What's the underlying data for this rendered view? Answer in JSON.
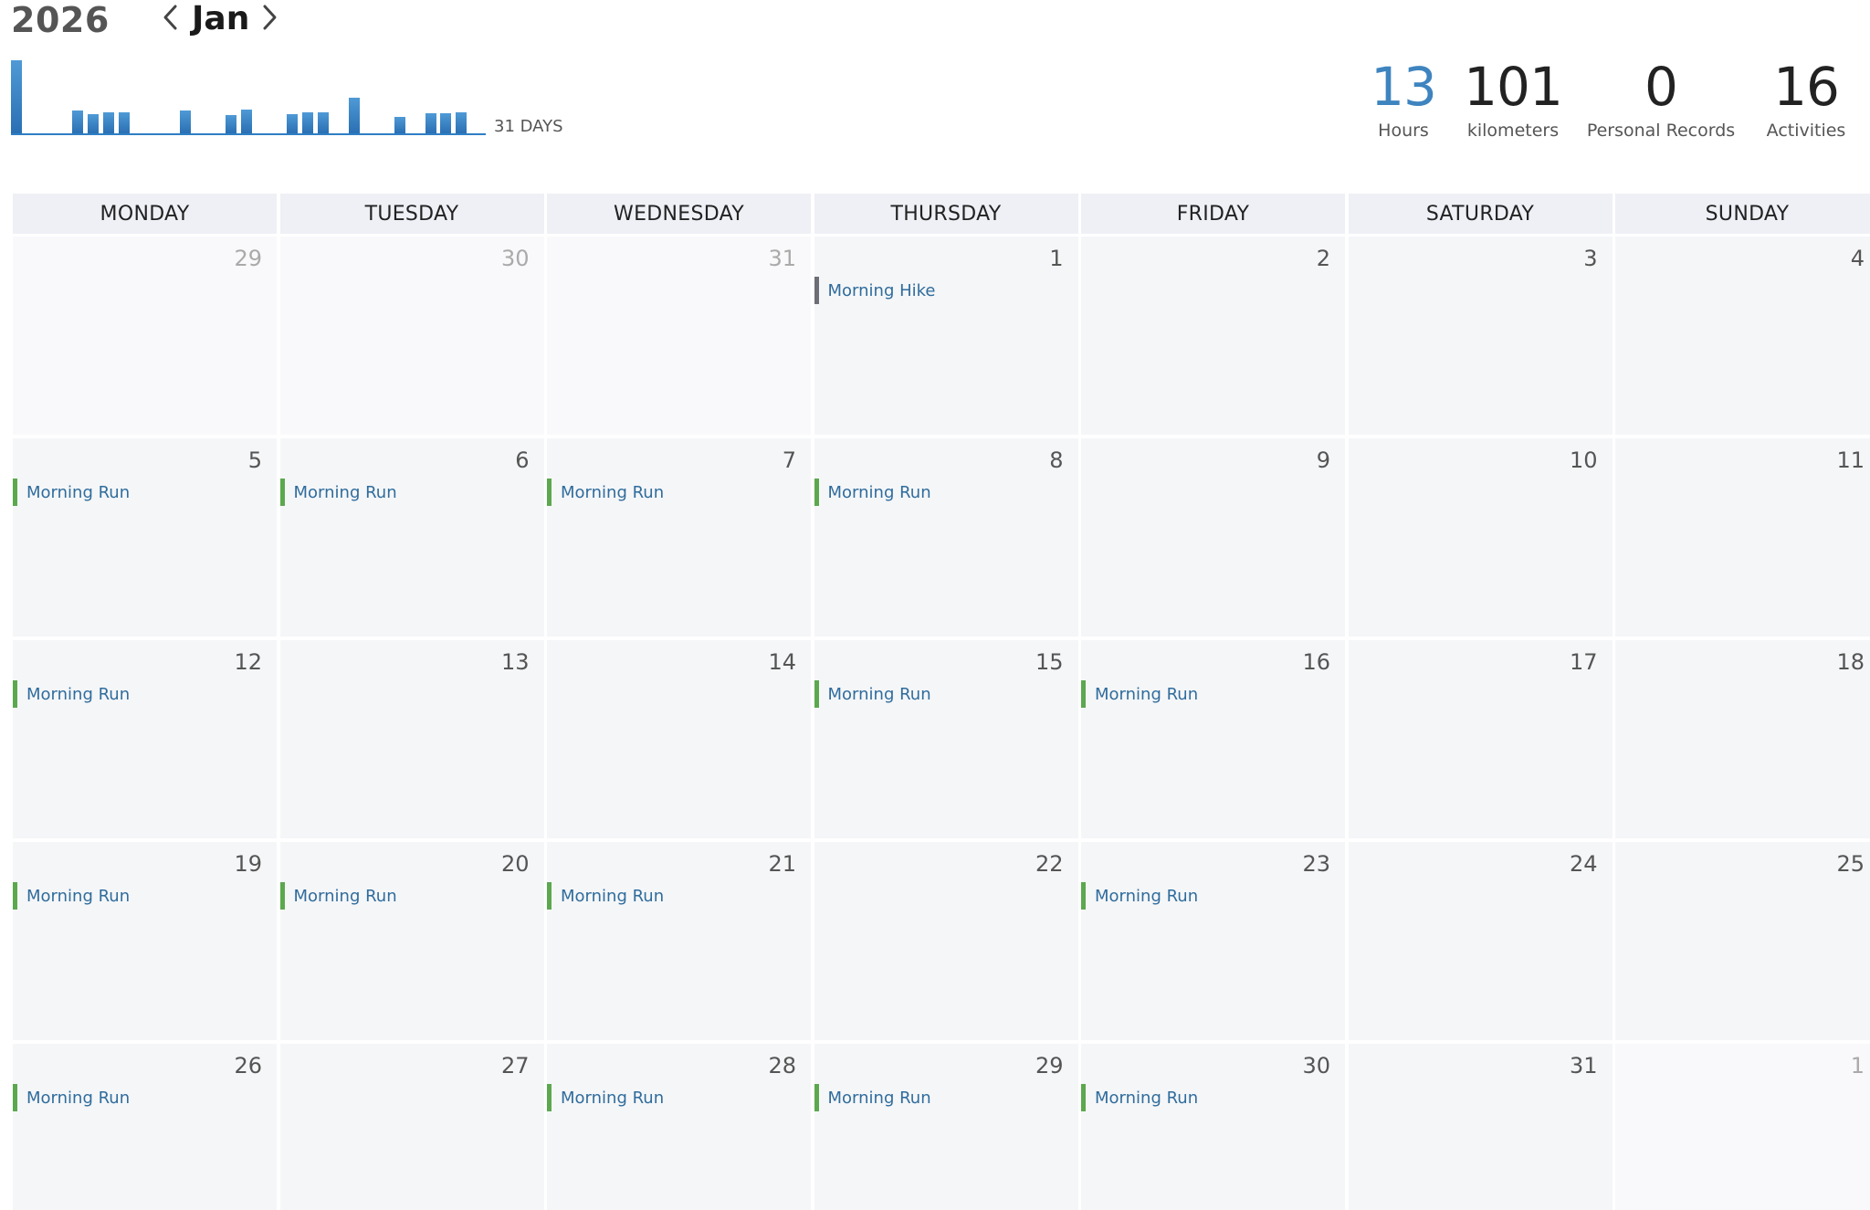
{
  "header": {
    "year": "2026",
    "month": "Jan",
    "days_label": "31 DAYS"
  },
  "activity_histogram": [
    {
      "day": 1,
      "level": 0.87
    },
    {
      "day": 5,
      "level": 0.27
    },
    {
      "day": 6,
      "level": 0.23
    },
    {
      "day": 7,
      "level": 0.25
    },
    {
      "day": 8,
      "level": 0.25
    },
    {
      "day": 12,
      "level": 0.27
    },
    {
      "day": 15,
      "level": 0.22
    },
    {
      "day": 16,
      "level": 0.28
    },
    {
      "day": 19,
      "level": 0.23
    },
    {
      "day": 20,
      "level": 0.25
    },
    {
      "day": 21,
      "level": 0.25
    },
    {
      "day": 23,
      "level": 0.42
    },
    {
      "day": 26,
      "level": 0.2
    },
    {
      "day": 28,
      "level": 0.24
    },
    {
      "day": 29,
      "level": 0.24
    },
    {
      "day": 30,
      "level": 0.25
    }
  ],
  "stats": [
    {
      "value": "13",
      "label": "Hours",
      "accent": true
    },
    {
      "value": "101",
      "label": "kilometers",
      "accent": false
    },
    {
      "value": "0",
      "label": "Personal Records",
      "accent": false
    },
    {
      "value": "16",
      "label": "Activities",
      "accent": false
    }
  ],
  "weekdays": [
    "MONDAY",
    "TUESDAY",
    "WEDNESDAY",
    "THURSDAY",
    "FRIDAY",
    "SATURDAY",
    "SUNDAY"
  ],
  "colors": {
    "run": "#5ba84e",
    "hike": "#6e6e76",
    "accent": "#3e84bf",
    "event_text": "#2f6c9c"
  },
  "days": [
    {
      "num": "29",
      "other": true,
      "event": null
    },
    {
      "num": "30",
      "other": true,
      "event": null
    },
    {
      "num": "31",
      "other": true,
      "event": null
    },
    {
      "num": "1",
      "other": false,
      "event": {
        "label": "Morning Hike",
        "type": "hike"
      }
    },
    {
      "num": "2",
      "other": false,
      "event": null
    },
    {
      "num": "3",
      "other": false,
      "event": null
    },
    {
      "num": "4",
      "other": false,
      "event": null
    },
    {
      "num": "5",
      "other": false,
      "event": {
        "label": "Morning Run",
        "type": "run"
      }
    },
    {
      "num": "6",
      "other": false,
      "event": {
        "label": "Morning Run",
        "type": "run"
      }
    },
    {
      "num": "7",
      "other": false,
      "event": {
        "label": "Morning Run",
        "type": "run"
      }
    },
    {
      "num": "8",
      "other": false,
      "event": {
        "label": "Morning Run",
        "type": "run"
      }
    },
    {
      "num": "9",
      "other": false,
      "event": null
    },
    {
      "num": "10",
      "other": false,
      "event": null
    },
    {
      "num": "11",
      "other": false,
      "event": null
    },
    {
      "num": "12",
      "other": false,
      "event": {
        "label": "Morning Run",
        "type": "run"
      }
    },
    {
      "num": "13",
      "other": false,
      "event": null
    },
    {
      "num": "14",
      "other": false,
      "event": null
    },
    {
      "num": "15",
      "other": false,
      "event": {
        "label": "Morning Run",
        "type": "run"
      }
    },
    {
      "num": "16",
      "other": false,
      "event": {
        "label": "Morning Run",
        "type": "run"
      }
    },
    {
      "num": "17",
      "other": false,
      "event": null
    },
    {
      "num": "18",
      "other": false,
      "event": null
    },
    {
      "num": "19",
      "other": false,
      "event": {
        "label": "Morning Run",
        "type": "run"
      }
    },
    {
      "num": "20",
      "other": false,
      "event": {
        "label": "Morning Run",
        "type": "run"
      }
    },
    {
      "num": "21",
      "other": false,
      "event": {
        "label": "Morning Run",
        "type": "run"
      }
    },
    {
      "num": "22",
      "other": false,
      "event": null
    },
    {
      "num": "23",
      "other": false,
      "event": {
        "label": "Morning Run",
        "type": "run"
      }
    },
    {
      "num": "24",
      "other": false,
      "event": null
    },
    {
      "num": "25",
      "other": false,
      "event": null
    },
    {
      "num": "26",
      "other": false,
      "event": {
        "label": "Morning Run",
        "type": "run"
      }
    },
    {
      "num": "27",
      "other": false,
      "event": null
    },
    {
      "num": "28",
      "other": false,
      "event": {
        "label": "Morning Run",
        "type": "run"
      }
    },
    {
      "num": "29",
      "other": false,
      "event": {
        "label": "Morning Run",
        "type": "run"
      }
    },
    {
      "num": "30",
      "other": false,
      "event": {
        "label": "Morning Run",
        "type": "run"
      }
    },
    {
      "num": "31",
      "other": false,
      "event": null
    },
    {
      "num": "1",
      "other": true,
      "event": null
    }
  ]
}
